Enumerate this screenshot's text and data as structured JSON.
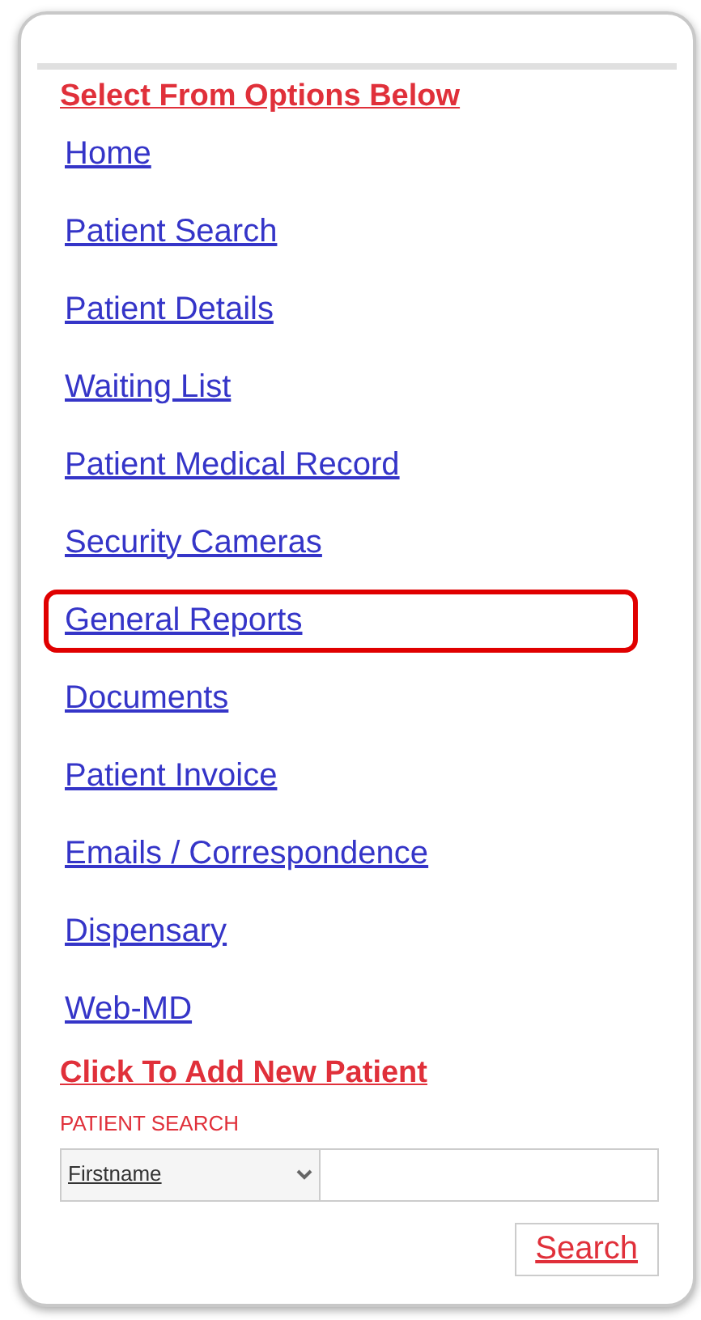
{
  "heading": "Select From Options Below",
  "menu": [
    {
      "label": "Home",
      "selected": false
    },
    {
      "label": "Patient Search",
      "selected": false
    },
    {
      "label": "Patient Details",
      "selected": false
    },
    {
      "label": "Waiting List",
      "selected": false
    },
    {
      "label": "Patient Medical Record",
      "selected": false
    },
    {
      "label": "Security Cameras",
      "selected": false
    },
    {
      "label": "General Reports",
      "selected": true
    },
    {
      "label": "Documents",
      "selected": false
    },
    {
      "label": "Patient Invoice",
      "selected": false
    },
    {
      "label": "Emails / Correspondence",
      "selected": false
    },
    {
      "label": "Dispensary",
      "selected": false
    },
    {
      "label": "Web-MD",
      "selected": false
    }
  ],
  "add_patient_link": "Click To Add New Patient",
  "patient_search": {
    "label": "PATIENT SEARCH",
    "field_select": "Firstname",
    "button": "Search"
  }
}
